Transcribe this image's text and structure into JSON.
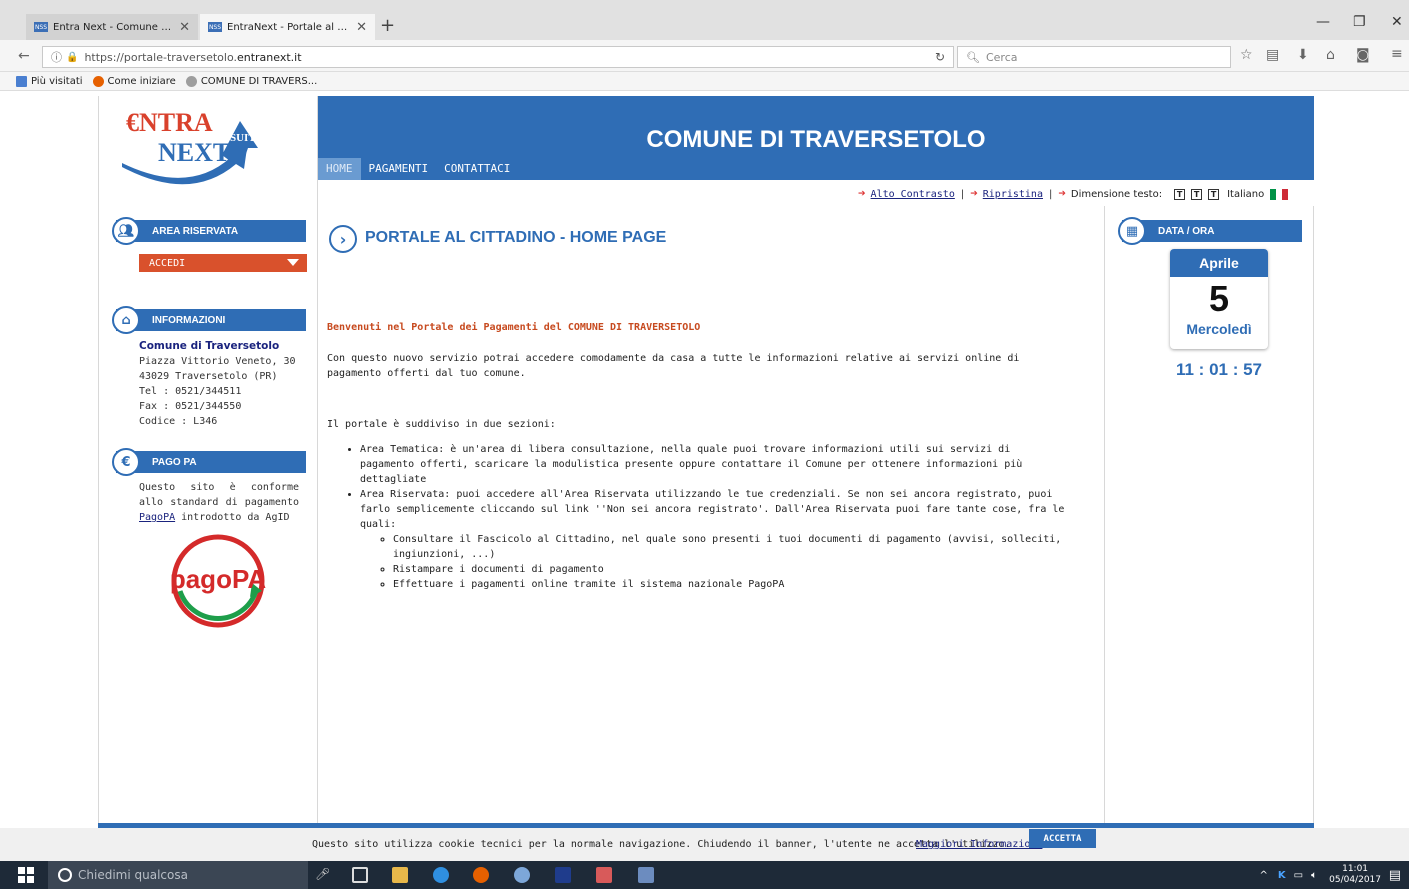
{
  "browser": {
    "tabs": [
      {
        "label": "Entra Next - Comune di Tr...",
        "favicon": "NSS"
      },
      {
        "label": "EntraNext - Portale al citta...",
        "favicon": "NSS"
      }
    ],
    "new_tab": "+",
    "url": {
      "prefix": "https://portale-traversetolo.",
      "host": "entranext.it"
    },
    "search_placeholder": "Cerca",
    "bookmarks": [
      "Più visitati",
      "Come iniziare",
      "COMUNE DI TRAVERS..."
    ]
  },
  "logo": {
    "line1": "€NTRA",
    "line2": "NEXT",
    "badge": "SUITE"
  },
  "header": {
    "title": "COMUNE DI TRAVERSETOLO",
    "menu": [
      "HOME",
      "PAGAMENTI",
      "CONTATTACI"
    ]
  },
  "accessibility": {
    "high_contrast": "Alto Contrasto",
    "restore": "Ripristina",
    "text_size_label": "Dimensione testo:",
    "t": "T",
    "language": "Italiano",
    "sep": "|"
  },
  "sidebar": {
    "area_riservata": {
      "title": "AREA RISERVATA",
      "login": "ACCEDI"
    },
    "informazioni": {
      "title": "INFORMAZIONI",
      "org": "Comune di Traversetolo",
      "lines": [
        "Piazza Vittorio Veneto, 30",
        "43029 Traversetolo (PR)",
        "Tel : 0521/344511",
        "Fax : 0521/344550",
        "Codice : L346"
      ]
    },
    "pago_pa": {
      "title": "PAGO PA",
      "text_before": "Questo sito è conforme allo standard di pagamento ",
      "link": "PagoPA",
      "text_after": " introdotto da AgID",
      "logo_text": "pagoPA"
    }
  },
  "main": {
    "title": "PORTALE AL CITTADINO - HOME PAGE",
    "welcome": "Benvenuti nel Portale dei Pagamenti del COMUNE DI TRAVERSETOLO",
    "intro": "Con questo nuovo servizio potrai accedere comodamente da casa a tutte le informazioni relative ai servizi online di pagamento offerti dal tuo comune.",
    "sections_intro": "Il portale è suddiviso in due sezioni:",
    "bullet1": "Area Tematica: è un'area di libera consultazione, nella quale puoi trovare informazioni utili sui servizi di pagamento offerti, scaricare la modulistica presente oppure contattare il Comune per ottenere informazioni più dettagliate",
    "bullet2": "Area Riservata: puoi accedere all'Area Riservata utilizzando le tue credenziali. Se non sei ancora registrato, puoi farlo semplicemente cliccando sul link ''Non sei ancora registrato'. Dall'Area Riservata puoi fare tante cose, fra le quali:",
    "sub_bullets": [
      "Consultare il Fascicolo al Cittadino, nel quale sono presenti i tuoi documenti di pagamento (avvisi, solleciti, ingiunzioni, ...)",
      "Ristampare i documenti di pagamento",
      "Effettuare i pagamenti online tramite il sistema nazionale PagoPA"
    ]
  },
  "datetime": {
    "title": "DATA / ORA",
    "month": "Aprile",
    "day": "5",
    "weekday": "Mercoledì",
    "time": "11 : 01 : 57"
  },
  "cookie": {
    "text": "Questo sito utilizza cookie tecnici per la normale navigazione. Chiudendo il banner, l'utente ne accetta l'utilizzo.",
    "link": "Maggiori Informazioni",
    "button": "ACCETTA"
  },
  "taskbar": {
    "search": "Chiedimi qualcosa",
    "time": "11:01",
    "date": "05/04/2017"
  },
  "colors": {
    "brand_blue": "#2f6db5",
    "accent_orange": "#d9512c"
  }
}
